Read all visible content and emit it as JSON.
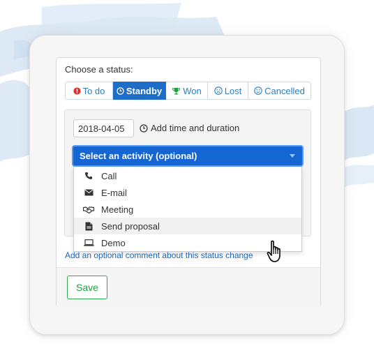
{
  "dialog": {
    "choose_label": "Choose a status:",
    "statuses": [
      {
        "label": "To do",
        "icon": "exclamation-circle-icon",
        "active": false,
        "icon_color": "#d9302b"
      },
      {
        "label": "Standby",
        "icon": "clock-icon",
        "active": true,
        "icon_color": "#ffffff"
      },
      {
        "label": "Won",
        "icon": "trophy-icon",
        "active": false,
        "icon_color": "#1aa33a"
      },
      {
        "label": "Lost",
        "icon": "sad-face-icon",
        "active": false,
        "icon_color": "#2a7fc1"
      },
      {
        "label": "Cancelled",
        "icon": "smile-face-icon",
        "active": false,
        "icon_color": "#2a7fc1"
      }
    ],
    "date_value": "2018-04-05",
    "time_link_label": "Add time and duration",
    "activity_select": {
      "selected": "Select an activity (optional)",
      "options": [
        {
          "label": "Call",
          "icon": "phone-icon"
        },
        {
          "label": "E-mail",
          "icon": "envelope-icon"
        },
        {
          "label": "Meeting",
          "icon": "handshake-icon"
        },
        {
          "label": "Send proposal",
          "icon": "document-icon"
        },
        {
          "label": "Demo",
          "icon": "laptop-icon"
        }
      ],
      "hovered_option": "Send proposal"
    },
    "comment_link": "Add an optional comment about this status change",
    "save_label": "Save"
  },
  "colors": {
    "accent_blue": "#1565d2",
    "active_status": "#1e6ec8",
    "link_blue": "#2a7fc1",
    "save_green": "#1f9e3f"
  }
}
